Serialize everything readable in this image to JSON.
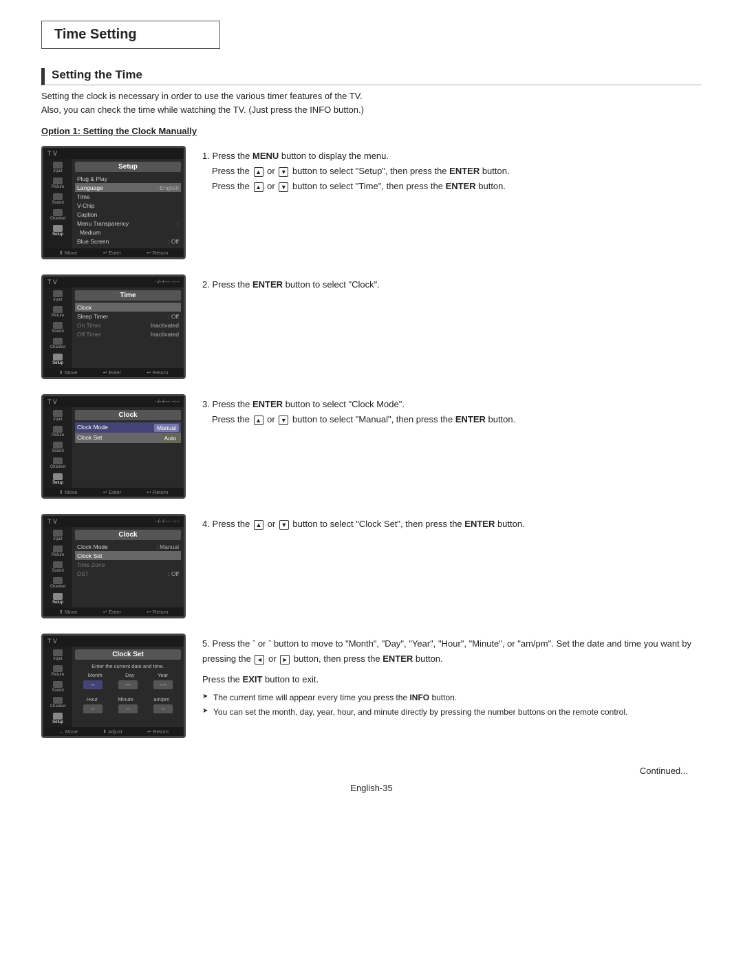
{
  "page": {
    "title": "Time Setting",
    "section_title": "Setting the Time",
    "intro": [
      "Setting the clock is necessary in order to use the various timer features of the TV.",
      "Also, you can check the time while watching the TV. (Just press the INFO button.)"
    ],
    "option_title": "Option 1: Setting the Clock Manually",
    "steps": [
      {
        "id": 1,
        "screen_title": "Setup",
        "instructions": [
          {
            "type": "normal",
            "text": "Press the ",
            "bold_part": "MENU",
            "rest": " button to display the menu."
          },
          {
            "type": "arrow_line",
            "pre": "Press the",
            "mid": "or",
            "post": "button to select \"Setup\", then press the ",
            "bold_end": "ENTER",
            "end": " button."
          },
          {
            "type": "arrow_line",
            "pre": "Press the",
            "mid": "or",
            "post": "button to select \"Time\", then press the ",
            "bold_end": "ENTER",
            "end": " button."
          }
        ],
        "menu_items": [
          {
            "label": "Plug & Play",
            "value": ""
          },
          {
            "label": "Language",
            "value": ": English"
          },
          {
            "label": "Time",
            "value": ""
          },
          {
            "label": "V-Chip",
            "value": ""
          },
          {
            "label": "Caption",
            "value": ""
          },
          {
            "label": "Menu Transparency",
            "value": ": Medium"
          },
          {
            "label": "Blue Screen",
            "value": ": Off"
          }
        ]
      },
      {
        "id": 2,
        "screen_title": "Time",
        "instruction": "Press the ENTER button to select \"Clock\".",
        "menu_items": [
          {
            "label": "Clock",
            "value": "",
            "selected": true
          },
          {
            "label": "Sleep Timer",
            "value": ": Off"
          },
          {
            "label": "On Timer",
            "value": "Inactivated"
          },
          {
            "label": "Off Timer",
            "value": "Inactivated"
          }
        ]
      },
      {
        "id": 3,
        "screen_title": "Clock",
        "instructions_main": "Press the ENTER button to select \"Clock Mode\".",
        "instructions_sub": "Press the or button to select \"Manual\", then press the ENTER button.",
        "menu_items": [
          {
            "label": "Clock Mode",
            "value": ": Manual",
            "highlighted": true
          },
          {
            "label": "Clock Set",
            "value": ": Auto"
          }
        ]
      },
      {
        "id": 4,
        "screen_title": "Clock",
        "instruction": "Press the or button to select \"Clock Set\", then press the ENTER button.",
        "menu_items": [
          {
            "label": "Clock Mode",
            "value": ": Manual"
          },
          {
            "label": "Clock Set",
            "value": "",
            "selected": true
          },
          {
            "label": "Time Zone",
            "value": ""
          },
          {
            "label": "DST",
            "value": ": Off"
          }
        ]
      },
      {
        "id": 5,
        "screen_title": "Clock Set",
        "sub_text": "Enter the current date and time.",
        "instruction_main": "Press the ˇ or ˆ button to move to \"Month\", \"Day\", \"Year\", \"Hour\", \"Minute\", or \"am/pm\". Set the date and time you want by pressing the or button, then press the ENTER button.",
        "instruction_exit": "Press the EXIT button to exit.",
        "bullets": [
          "The current time will appear every time you press the INFO button.",
          "You can set the month, day, year, hour, and minute directly by pressing the number buttons on the remote control."
        ],
        "date_labels": [
          "Month",
          "Day",
          "Year"
        ],
        "time_labels": [
          "Hour",
          "Minute",
          "am/pm"
        ],
        "date_values": [
          "--",
          "---",
          "----"
        ],
        "time_values": [
          "--",
          "--",
          "--"
        ]
      }
    ],
    "continued": "Continued...",
    "page_number": "English-35"
  }
}
